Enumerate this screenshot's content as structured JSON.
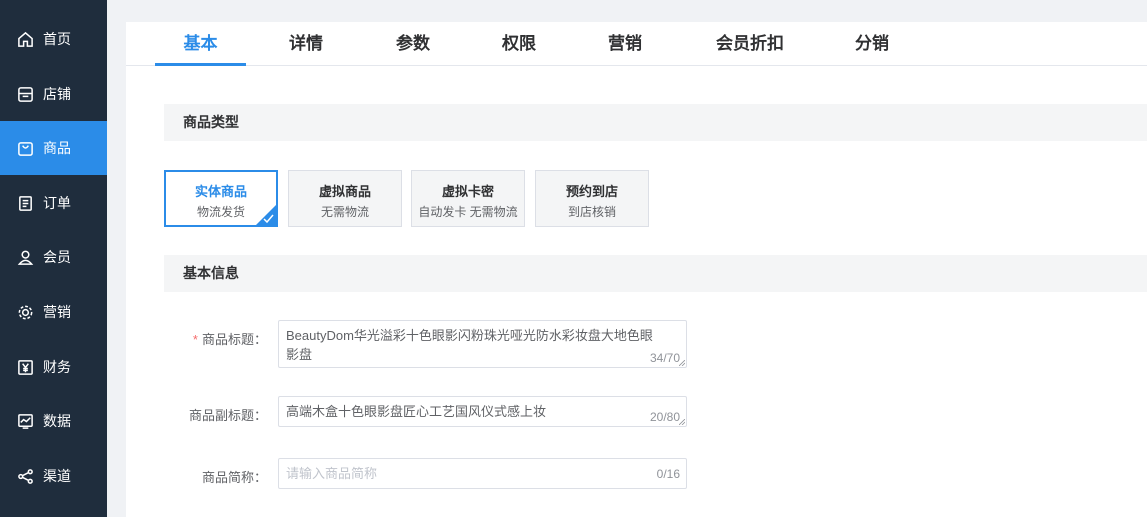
{
  "sidebar": {
    "items": [
      {
        "label": "首页",
        "icon": "home-icon"
      },
      {
        "label": "店铺",
        "icon": "store-icon"
      },
      {
        "label": "商品",
        "icon": "bag-icon",
        "active": true
      },
      {
        "label": "订单",
        "icon": "order-icon"
      },
      {
        "label": "会员",
        "icon": "user-icon"
      },
      {
        "label": "营销",
        "icon": "gear-icon"
      },
      {
        "label": "财务",
        "icon": "yen-icon"
      },
      {
        "label": "数据",
        "icon": "chart-icon"
      },
      {
        "label": "渠道",
        "icon": "share-icon"
      }
    ]
  },
  "tabs": [
    "基本",
    "详情",
    "参数",
    "权限",
    "营销",
    "会员折扣",
    "分销"
  ],
  "active_tab": "基本",
  "sections": {
    "product_type": "商品类型",
    "basic_info": "基本信息"
  },
  "product_types": [
    {
      "title": "实体商品",
      "subtitle": "物流发货",
      "selected": true
    },
    {
      "title": "虚拟商品",
      "subtitle": "无需物流"
    },
    {
      "title": "虚拟卡密",
      "subtitle": "自动发卡 无需物流"
    },
    {
      "title": "预约到店",
      "subtitle": "到店核销"
    }
  ],
  "form": {
    "title": {
      "label": "商品标题：",
      "required_mark": "*",
      "value": "BeautyDom华光溢彩十色眼影闪粉珠光哑光防水彩妆盘大地色眼影盘",
      "count": "34/70"
    },
    "subtitle": {
      "label": "商品副标题：",
      "value": "高端木盒十色眼影盘匠心工艺国风仪式感上妆",
      "count": "20/80"
    },
    "short_name": {
      "label": "商品简称：",
      "placeholder": "请输入商品简称",
      "count": "0/16"
    }
  },
  "colors": {
    "accent": "#2b8ce8",
    "sidebar_bg": "#1f2d3d",
    "required": "#f56c6c"
  }
}
